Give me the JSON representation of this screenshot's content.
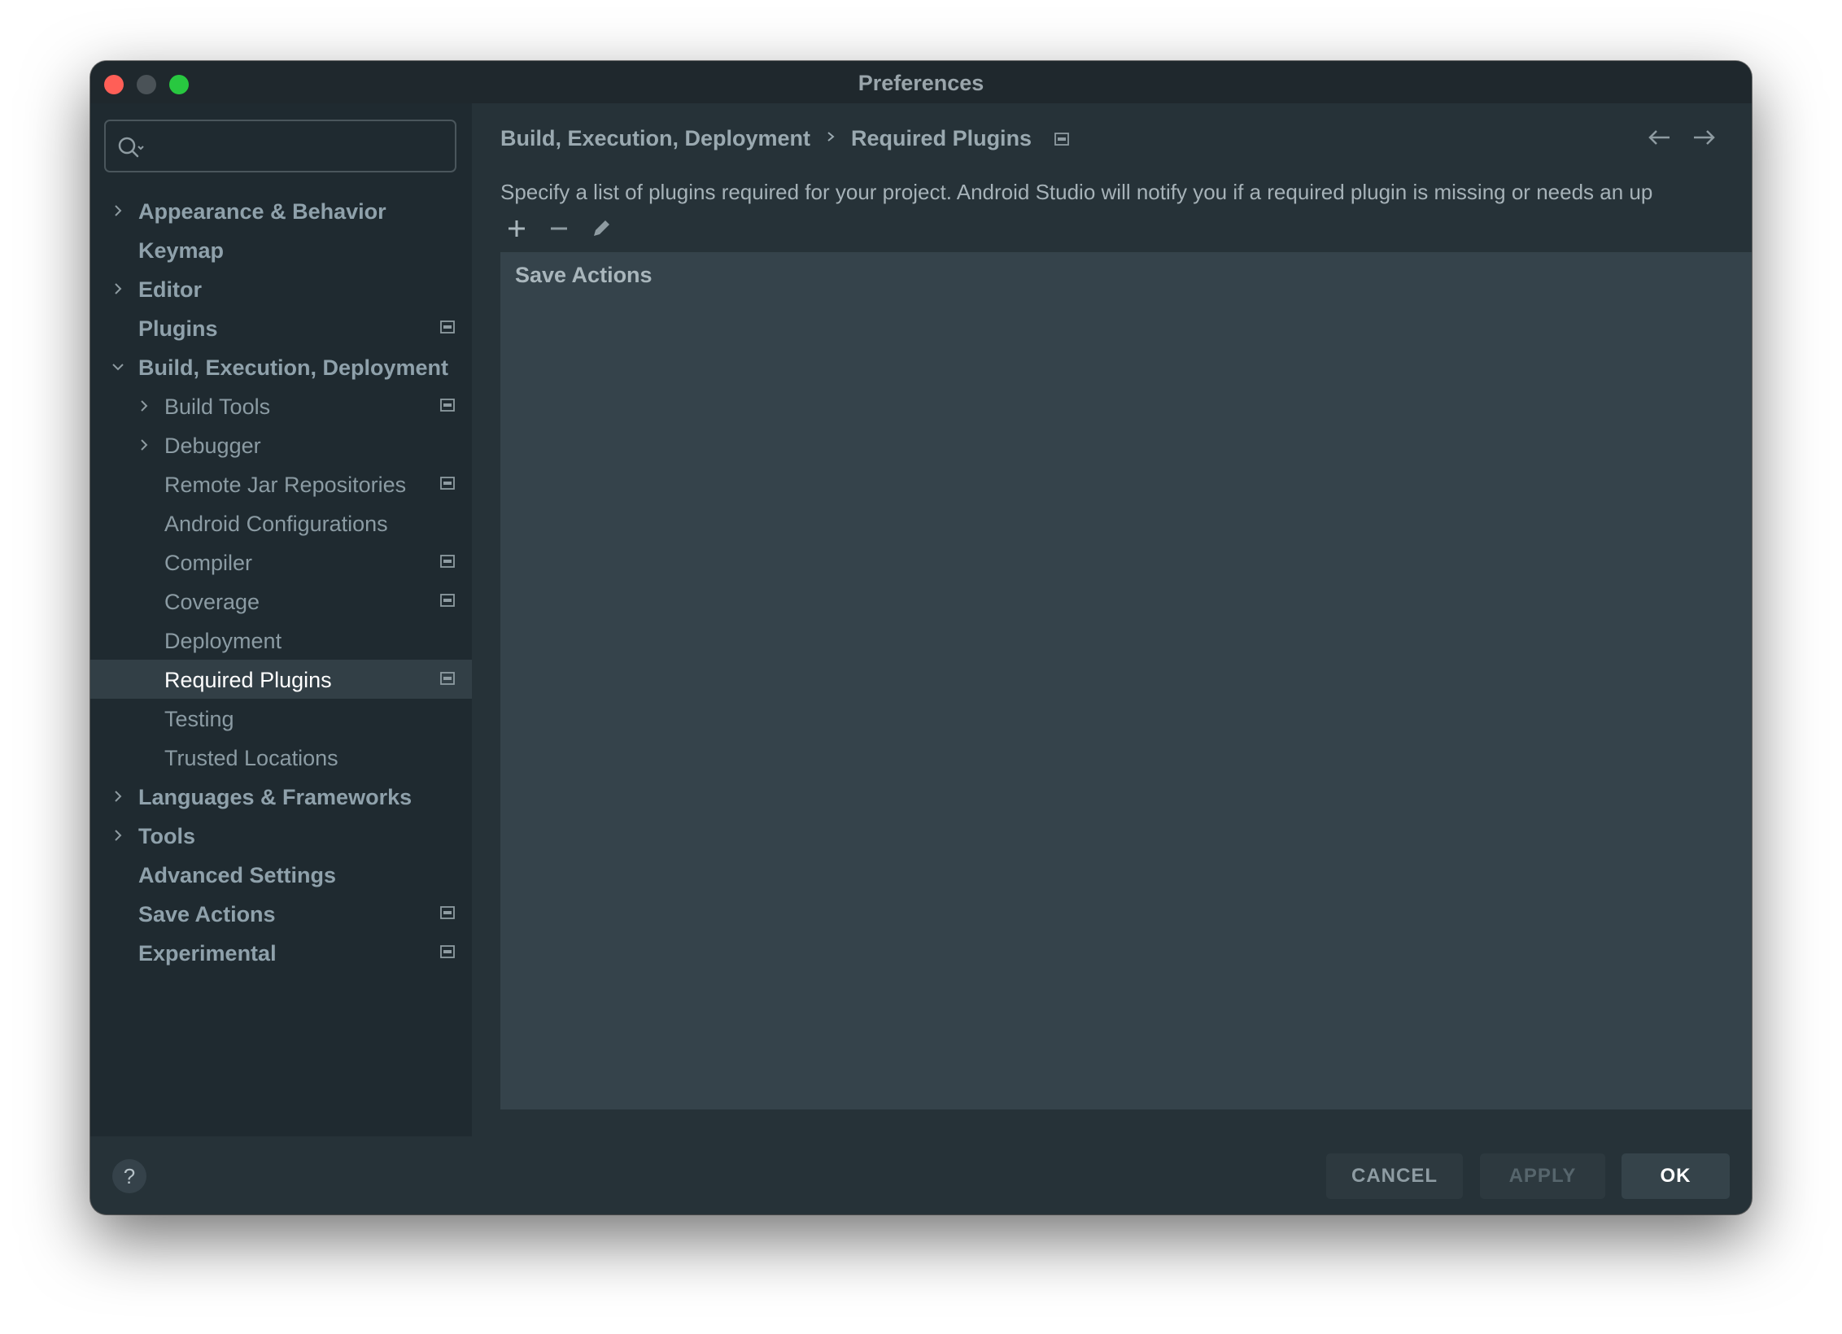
{
  "window": {
    "title": "Preferences"
  },
  "search": {
    "value": "",
    "placeholder": ""
  },
  "sidebar": {
    "items": [
      {
        "label": "Appearance & Behavior",
        "level": 0,
        "expandable": true,
        "expanded": false,
        "badge": false
      },
      {
        "label": "Keymap",
        "level": 0,
        "expandable": false,
        "badge": false
      },
      {
        "label": "Editor",
        "level": 0,
        "expandable": true,
        "expanded": false,
        "badge": false
      },
      {
        "label": "Plugins",
        "level": 0,
        "expandable": false,
        "badge": true
      },
      {
        "label": "Build, Execution, Deployment",
        "level": 0,
        "expandable": true,
        "expanded": true,
        "badge": false
      },
      {
        "label": "Build Tools",
        "level": 1,
        "expandable": true,
        "expanded": false,
        "badge": true
      },
      {
        "label": "Debugger",
        "level": 1,
        "expandable": true,
        "expanded": false,
        "badge": false
      },
      {
        "label": "Remote Jar Repositories",
        "level": 1,
        "expandable": false,
        "badge": true
      },
      {
        "label": "Android Configurations",
        "level": 1,
        "expandable": false,
        "badge": false
      },
      {
        "label": "Compiler",
        "level": 1,
        "expandable": false,
        "badge": true
      },
      {
        "label": "Coverage",
        "level": 1,
        "expandable": false,
        "badge": true
      },
      {
        "label": "Deployment",
        "level": 1,
        "expandable": false,
        "badge": false
      },
      {
        "label": "Required Plugins",
        "level": 1,
        "expandable": false,
        "badge": true,
        "selected": true
      },
      {
        "label": "Testing",
        "level": 1,
        "expandable": false,
        "badge": false
      },
      {
        "label": "Trusted Locations",
        "level": 1,
        "expandable": false,
        "badge": false
      },
      {
        "label": "Languages & Frameworks",
        "level": 0,
        "expandable": true,
        "expanded": false,
        "badge": false
      },
      {
        "label": "Tools",
        "level": 0,
        "expandable": true,
        "expanded": false,
        "badge": false
      },
      {
        "label": "Advanced Settings",
        "level": 0,
        "expandable": false,
        "badge": false
      },
      {
        "label": "Save Actions",
        "level": 0,
        "expandable": false,
        "badge": true
      },
      {
        "label": "Experimental",
        "level": 0,
        "expandable": false,
        "badge": true
      }
    ]
  },
  "breadcrumb": {
    "parent": "Build, Execution, Deployment",
    "current": "Required Plugins"
  },
  "content": {
    "description": "Specify a list of plugins required for your project. Android Studio will notify you if a required plugin is missing or needs an up",
    "toolbar": [
      "plus-icon",
      "minus-icon",
      "pencil-icon"
    ],
    "plugins": [
      "Save Actions"
    ]
  },
  "footer": {
    "help_label": "?",
    "cancel_label": "CANCEL",
    "apply_label": "APPLY",
    "ok_label": "OK"
  },
  "colors": {
    "background": "#263238",
    "sidebar": "#1f2a30",
    "selected": "#323f46",
    "list": "#35434b",
    "close": "#ff5f57",
    "maximize": "#28c840"
  }
}
